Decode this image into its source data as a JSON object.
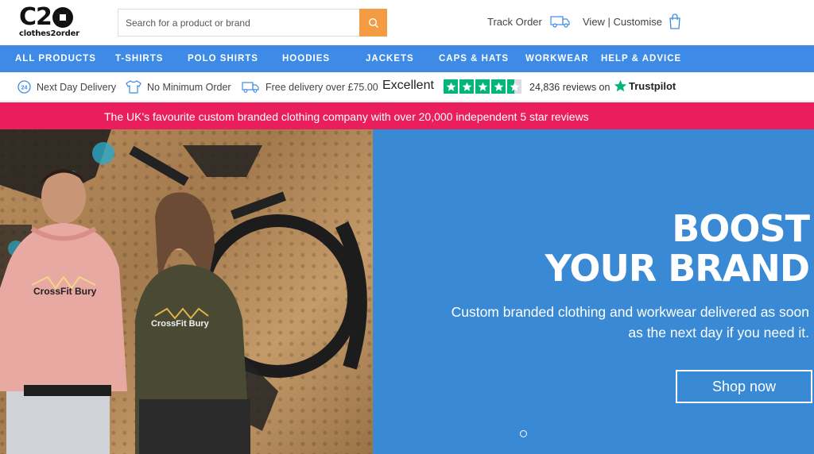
{
  "header": {
    "logo_text": "C2O",
    "logo_sub": "clothes2order",
    "search_placeholder": "Search for a product or brand",
    "track_order": "Track Order",
    "view_customise": "View | Customise"
  },
  "nav": {
    "items": [
      "ALL PRODUCTS",
      "T-SHIRTS",
      "POLO SHIRTS",
      "HOODIES",
      "JACKETS",
      "CAPS & HATS",
      "WORKWEAR",
      "HELP & ADVICE"
    ]
  },
  "usp": {
    "next_day": "Next Day Delivery",
    "next_day_badge": "24",
    "no_minimum": "No Minimum Order",
    "free_delivery": "Free delivery over £75.00",
    "rating_word": "Excellent",
    "stars": 4.5,
    "reviews": "24,836 reviews on",
    "trustpilot": "Trustpilot",
    "trustpilot_color": "#00b67a"
  },
  "promo": {
    "text": "The UK's favourite custom branded clothing company with over 20,000 independent 5 star reviews",
    "color": "#e91e5a"
  },
  "hero": {
    "title_line1": "BOOST",
    "title_line2": "YOUR BRAND",
    "subtitle_line1": "Custom branded clothing and workwear delivered as soon",
    "subtitle_line2": "as the next day if you need it.",
    "cta": "Shop now",
    "photo_text_1": "CrossFit Bury",
    "photo_text_2": "CrossFit Bury",
    "panel_color": "#3a89d4"
  },
  "colors": {
    "nav": "#3d8be6",
    "search_button": "#f39c44"
  }
}
